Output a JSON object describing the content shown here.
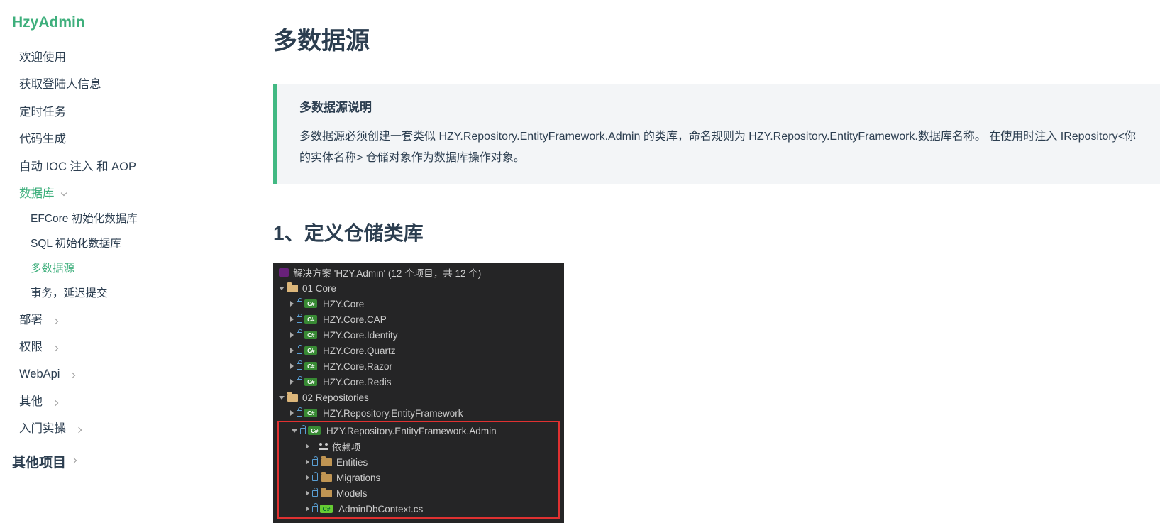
{
  "site": {
    "title": "HzyAdmin"
  },
  "nav": {
    "items": [
      "欢迎使用",
      "获取登陆人信息",
      "定时任务",
      "代码生成",
      "自动 IOC 注入 和 AOP"
    ],
    "db_group": "数据库",
    "db_children": [
      "EFCore 初始化数据库",
      "SQL 初始化数据库",
      "多数据源",
      "事务，延迟提交"
    ],
    "collapsed": [
      "部署",
      "权限",
      "WebApi",
      "其他",
      "入门实操"
    ],
    "section2": "其他项目"
  },
  "page": {
    "title": "多数据源",
    "tip_title": "多数据源说明",
    "tip_text": "多数据源必须创建一套类似 HZY.Repository.EntityFramework.Admin 的类库，命名规则为 HZY.Repository.EntityFramework.数据库名称。 在使用时注入 IRepository<你的实体名称> 仓储对象作为数据库操作对象。",
    "h2": "1、定义仓储类库"
  },
  "vs": {
    "solution": "解决方案 'HZY.Admin' (12 个项目，共 12 个)",
    "folder1": "01 Core",
    "p1": "HZY.Core",
    "p2": "HZY.Core.CAP",
    "p3": "HZY.Core.Identity",
    "p4": "HZY.Core.Quartz",
    "p5": "HZY.Core.Razor",
    "p6": "HZY.Core.Redis",
    "folder2": "02 Repositories",
    "p7": "HZY.Repository.EntityFramework",
    "p8": "HZY.Repository.EntityFramework.Admin",
    "dep": "依赖项",
    "f1": "Entities",
    "f2": "Migrations",
    "f3": "Models",
    "file1": "AdminDbContext.cs"
  }
}
